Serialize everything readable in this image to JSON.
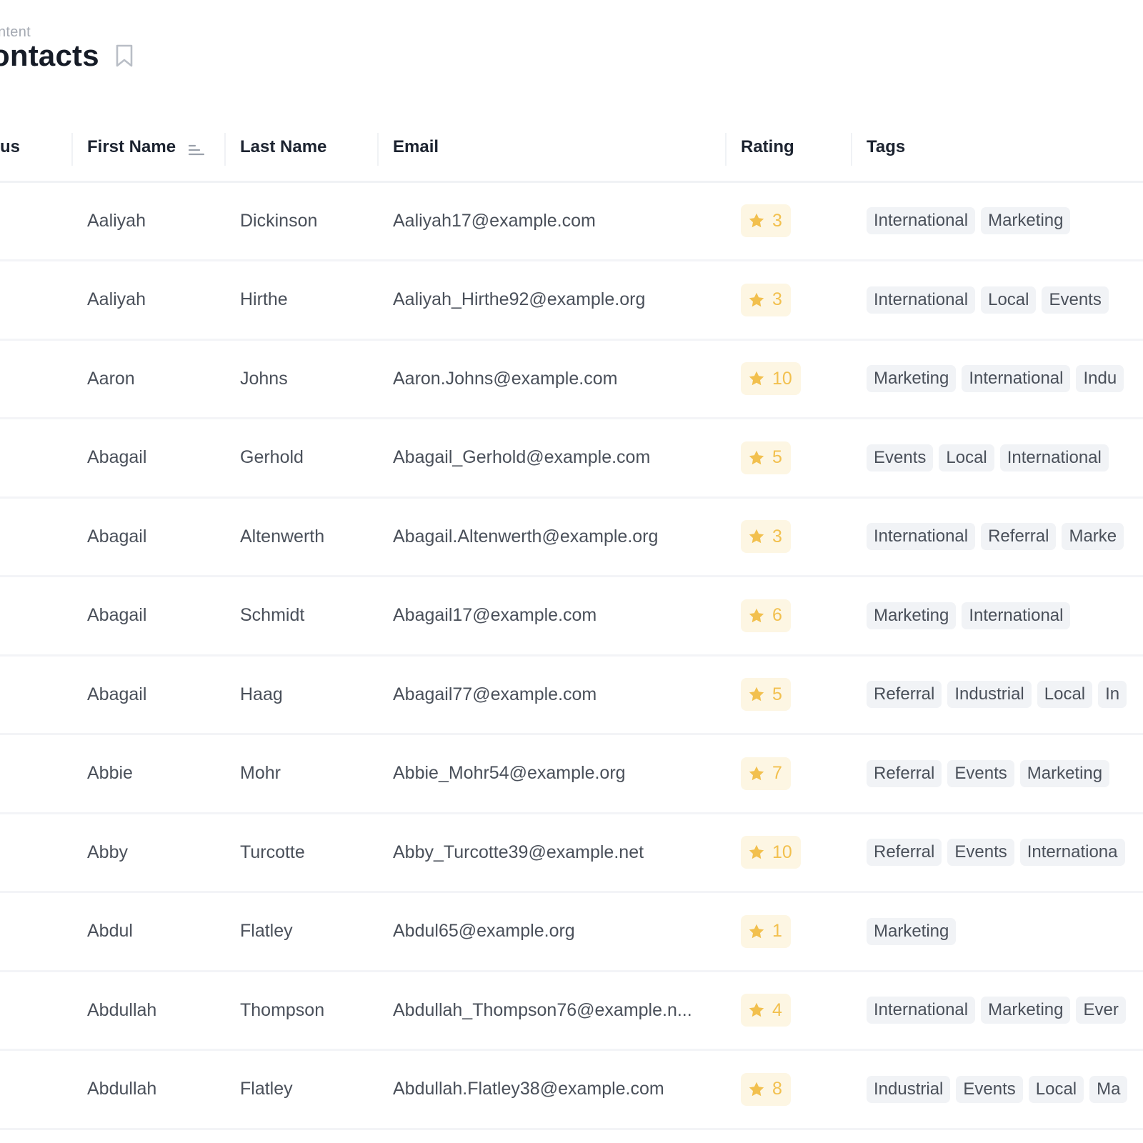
{
  "header": {
    "breadcrumb": "ntent",
    "title": "ontacts"
  },
  "columns": {
    "status": "us",
    "first_name": "First Name",
    "last_name": "Last Name",
    "email": "Email",
    "rating": "Rating",
    "tags": "Tags"
  },
  "colors": {
    "rating_star": "#f2c04e",
    "rating_bg": "#fdf6e3",
    "tag_bg": "#f1f3f6"
  },
  "rows": [
    {
      "first": "Aaliyah",
      "last": "Dickinson",
      "email": "Aaliyah17@example.com",
      "rating": "3",
      "tags": [
        "International",
        "Marketing"
      ]
    },
    {
      "first": "Aaliyah",
      "last": "Hirthe",
      "email": "Aaliyah_Hirthe92@example.org",
      "rating": "3",
      "tags": [
        "International",
        "Local",
        "Events"
      ]
    },
    {
      "first": "Aaron",
      "last": "Johns",
      "email": "Aaron.Johns@example.com",
      "rating": "10",
      "tags": [
        "Marketing",
        "International",
        "Indu"
      ]
    },
    {
      "first": "Abagail",
      "last": "Gerhold",
      "email": "Abagail_Gerhold@example.com",
      "rating": "5",
      "tags": [
        "Events",
        "Local",
        "International"
      ]
    },
    {
      "first": "Abagail",
      "last": "Altenwerth",
      "email": "Abagail.Altenwerth@example.org",
      "rating": "3",
      "tags": [
        "International",
        "Referral",
        "Marke"
      ]
    },
    {
      "first": "Abagail",
      "last": "Schmidt",
      "email": "Abagail17@example.com",
      "rating": "6",
      "tags": [
        "Marketing",
        "International"
      ]
    },
    {
      "first": "Abagail",
      "last": "Haag",
      "email": "Abagail77@example.com",
      "rating": "5",
      "tags": [
        "Referral",
        "Industrial",
        "Local",
        "In"
      ]
    },
    {
      "first": "Abbie",
      "last": "Mohr",
      "email": "Abbie_Mohr54@example.org",
      "rating": "7",
      "tags": [
        "Referral",
        "Events",
        "Marketing"
      ]
    },
    {
      "first": "Abby",
      "last": "Turcotte",
      "email": "Abby_Turcotte39@example.net",
      "rating": "10",
      "tags": [
        "Referral",
        "Events",
        "Internationa"
      ]
    },
    {
      "first": "Abdul",
      "last": "Flatley",
      "email": "Abdul65@example.org",
      "rating": "1",
      "tags": [
        "Marketing"
      ]
    },
    {
      "first": "Abdullah",
      "last": "Thompson",
      "email": "Abdullah_Thompson76@example.n...",
      "rating": "4",
      "tags": [
        "International",
        "Marketing",
        "Ever"
      ]
    },
    {
      "first": "Abdullah",
      "last": "Flatley",
      "email": "Abdullah.Flatley38@example.com",
      "rating": "8",
      "tags": [
        "Industrial",
        "Events",
        "Local",
        "Ma"
      ]
    }
  ]
}
